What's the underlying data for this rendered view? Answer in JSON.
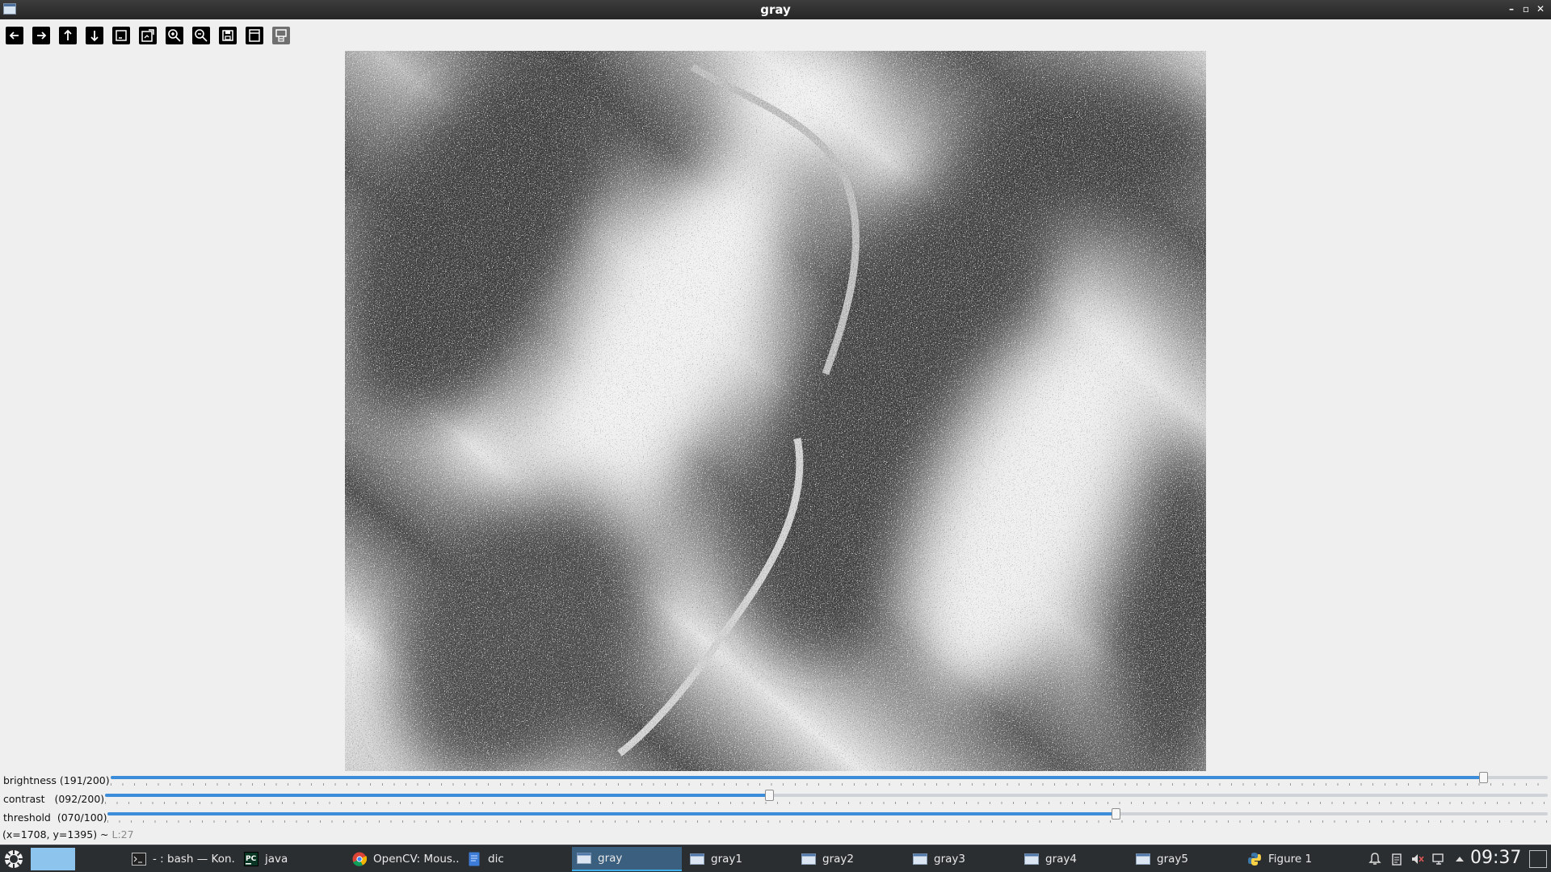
{
  "window": {
    "title": "gray",
    "controls": [
      "minimize-icon",
      "restore-icon",
      "close-icon"
    ]
  },
  "toolbar": {
    "buttons": [
      {
        "name": "pan-left-button",
        "icon": "arrow-left-icon"
      },
      {
        "name": "pan-right-button",
        "icon": "arrow-right-icon"
      },
      {
        "name": "pan-up-button",
        "icon": "arrow-up-icon"
      },
      {
        "name": "pan-down-button",
        "icon": "arrow-down-icon"
      },
      {
        "name": "zoom-original-button",
        "icon": "zoom-x1-icon"
      },
      {
        "name": "zoom-fit-button",
        "icon": "zoom-fit-icon"
      },
      {
        "name": "zoom-in-button",
        "icon": "zoom-in-icon"
      },
      {
        "name": "zoom-out-button",
        "icon": "zoom-out-icon"
      },
      {
        "name": "save-button",
        "icon": "save-icon"
      },
      {
        "name": "properties-button",
        "icon": "properties-icon"
      },
      {
        "name": "copy-button",
        "icon": "copy-icon"
      }
    ]
  },
  "image": {
    "description_icon": "grayscale-terrain-image"
  },
  "trackbars": [
    {
      "label": "brightness (191/200)",
      "value": 191,
      "max": 200
    },
    {
      "label": "contrast   (092/200)",
      "value": 92,
      "max": 200
    },
    {
      "label": "threshold  (070/100)",
      "value": 70,
      "max": 100
    }
  ],
  "status": {
    "coords": "(x=1708, y=1395) ~ ",
    "extra": "L:27"
  },
  "taskbar": {
    "tasks": [
      {
        "label": "- : bash — Kon...",
        "icon": "terminal-icon",
        "active": false
      },
      {
        "label": "java",
        "icon": "pycharm-icon",
        "active": false
      },
      {
        "label": "OpenCV: Mous...",
        "icon": "chrome-icon",
        "active": false
      },
      {
        "label": "dic",
        "icon": "document-icon",
        "active": false
      },
      {
        "label": "gray",
        "icon": "window-icon",
        "active": true
      },
      {
        "label": "gray1",
        "icon": "window-icon",
        "active": false
      },
      {
        "label": "gray2",
        "icon": "window-icon",
        "active": false
      },
      {
        "label": "gray3",
        "icon": "window-icon",
        "active": false
      },
      {
        "label": "gray4",
        "icon": "window-icon",
        "active": false
      },
      {
        "label": "gray5",
        "icon": "window-icon",
        "active": false
      },
      {
        "label": "Figure 1",
        "icon": "python-icon",
        "active": false
      }
    ],
    "clock": "09:37",
    "accent": "#3daee9"
  }
}
